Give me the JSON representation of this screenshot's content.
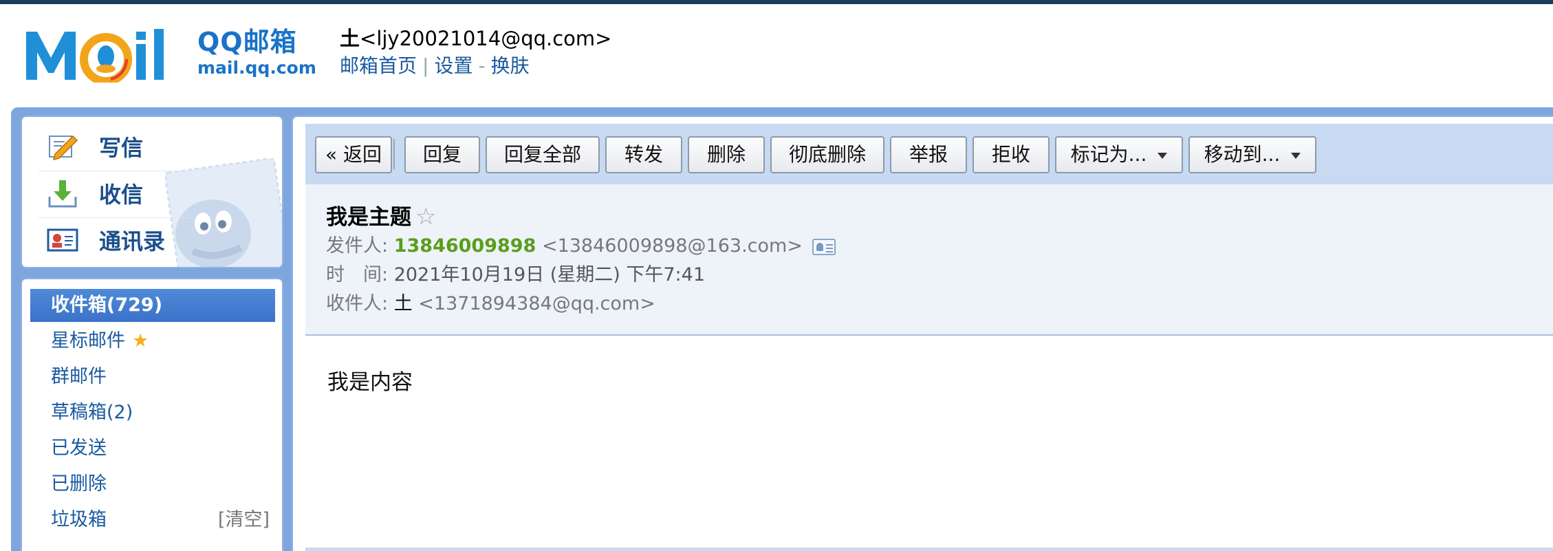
{
  "header": {
    "brand_name": "QQ邮箱",
    "brand_domain": "mail.qq.com",
    "user_name": "土",
    "user_email": "<ljy20021014@qq.com>",
    "links": [
      "邮箱首页",
      "设置",
      "换肤"
    ]
  },
  "sidebar": {
    "quick_actions": [
      {
        "label": "写信",
        "icon": "compose-icon"
      },
      {
        "label": "收信",
        "icon": "inbox-download-icon"
      },
      {
        "label": "通讯录",
        "icon": "contacts-icon"
      }
    ],
    "folders": [
      {
        "label": "收件箱(729)",
        "active": true
      },
      {
        "label": "星标邮件",
        "star": "★"
      },
      {
        "label": "群邮件"
      },
      {
        "label": "草稿箱(2)"
      },
      {
        "label": "已发送"
      },
      {
        "label": "已删除"
      },
      {
        "label": "垃圾箱",
        "action": "[清空]"
      }
    ]
  },
  "toolbar": {
    "back": "« 返回",
    "reply": "回复",
    "reply_all": "回复全部",
    "forward": "转发",
    "delete": "删除",
    "delete_permanent": "彻底删除",
    "report": "举报",
    "reject": "拒收",
    "mark_as": "标记为...",
    "move_to": "移动到..."
  },
  "message": {
    "subject": "我是主题",
    "star": "☆",
    "from_label": "发件人:",
    "from_name": "13846009898",
    "from_email": "<13846009898@163.com>",
    "time_label": "时　间:",
    "time_value": "2021年10月19日 (星期二) 下午7:41",
    "to_label": "收件人:",
    "to_name": "土",
    "to_email": "<1371894384@qq.com>",
    "body": "我是内容"
  },
  "colors": {
    "accent": "#1b73c7",
    "frame": "#7ea6de",
    "sender": "#5a9e1b",
    "active_folder": "#3a72c8"
  }
}
